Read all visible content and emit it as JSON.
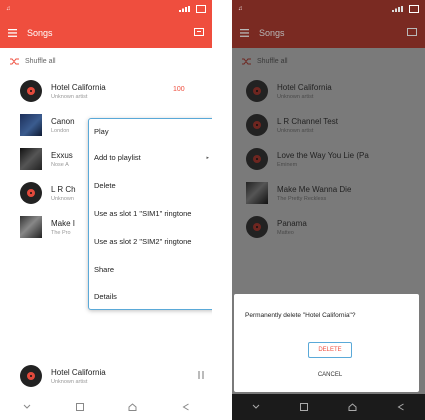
{
  "colors": {
    "accent": "#ef4e3e",
    "dialog_border": "#5aa9d8"
  },
  "left": {
    "appbar": {
      "title": "Songs"
    },
    "shuffle_label": "Shuffle all",
    "songs": [
      {
        "title": "Hotel California",
        "subtitle": "Unknown artist",
        "badge": "100",
        "thumb": "vinyl-disc-icon"
      },
      {
        "title": "Canon",
        "subtitle": "London",
        "thumb": "album-art"
      },
      {
        "title": "Exxus",
        "subtitle": "Nose A",
        "thumb": "album-art"
      },
      {
        "title": "L R Ch",
        "subtitle": "Unknown",
        "thumb": "vinyl-disc-icon"
      },
      {
        "title": "Make I",
        "subtitle": "The Pro",
        "thumb": "album-art"
      }
    ],
    "context_menu": [
      "Play",
      "Add to playlist",
      "Delete",
      "Use as slot 1 \"SIM1\" ringtone",
      "Use as slot 2 \"SIM2\" ringtone",
      "Share",
      "Details"
    ],
    "submenu_arrow": "▸",
    "now_playing": {
      "title": "Hotel California",
      "subtitle": "Unknown artist"
    }
  },
  "right": {
    "appbar": {
      "title": "Songs"
    },
    "shuffle_label": "Shuffle all",
    "songs": [
      {
        "title": "Hotel California",
        "subtitle": "Unknown artist"
      },
      {
        "title": "L R Channel Test",
        "subtitle": "Unknown artist"
      },
      {
        "title": "Love the Way You Lie (Pa",
        "subtitle": "Eminem"
      },
      {
        "title": "Make Me Wanna Die",
        "subtitle": "The Pretty Reckless"
      },
      {
        "title": "Panama",
        "subtitle": "Matteo"
      }
    ],
    "dialog": {
      "message": "Permanently delete \"Hotel California\"?",
      "delete_label": "DELETE",
      "cancel_label": "CANCEL"
    }
  }
}
